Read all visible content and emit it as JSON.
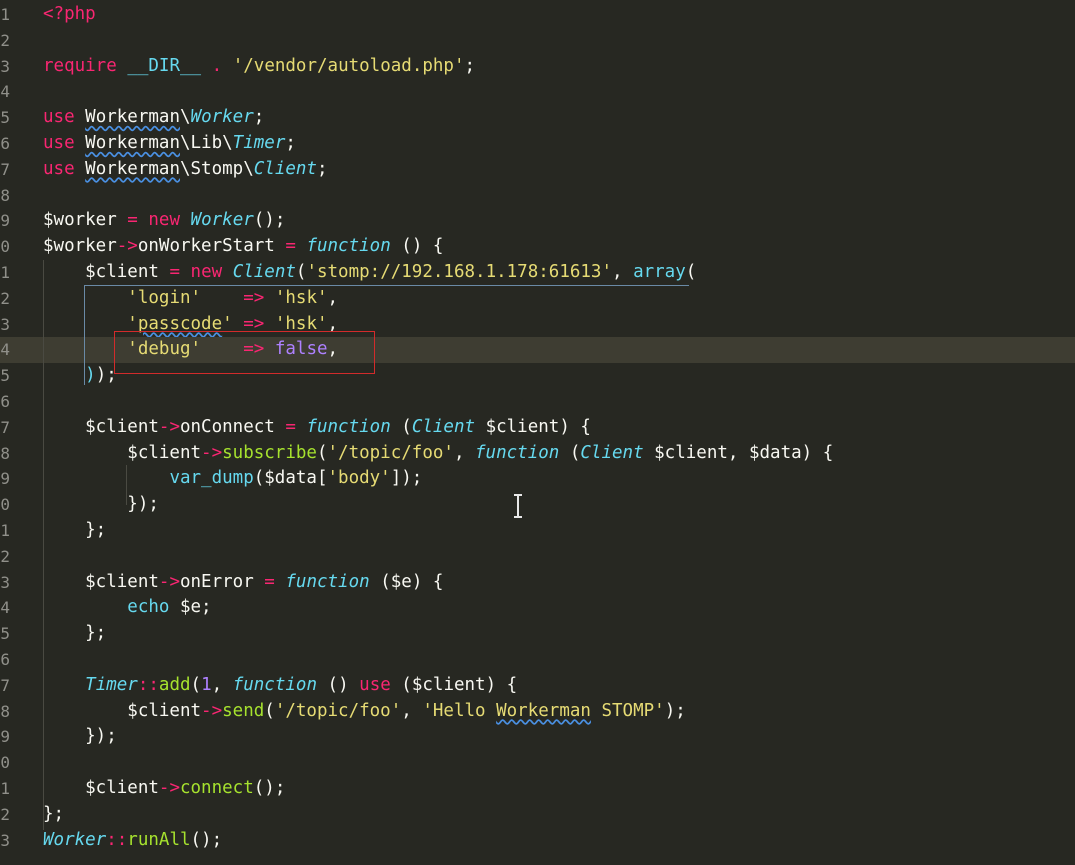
{
  "editor": {
    "language": "php",
    "theme_colors": {
      "background": "#272822",
      "keyword": "#f92672",
      "string": "#e6db74",
      "class": "#66d9ef",
      "function": "#a6e22e",
      "constant": "#ae81ff",
      "annotation_box": "#d22b2b"
    },
    "line_numbers": [
      "1",
      "2",
      "3",
      "4",
      "5",
      "6",
      "7",
      "8",
      "9",
      "0",
      "1",
      "2",
      "3",
      "4",
      "5",
      "6",
      "7",
      "8",
      "9",
      "0",
      "1",
      "2",
      "3",
      "4",
      "5",
      "6",
      "7",
      "8",
      "9",
      "0",
      "1",
      "2",
      "3"
    ],
    "highlighted_line": 14,
    "lines": [
      [
        [
          "kw",
          "<?php"
        ]
      ],
      [],
      [
        [
          "kw",
          "require"
        ],
        [
          "plain",
          " "
        ],
        [
          "cls-plain",
          "__DIR__"
        ],
        [
          "plain",
          " "
        ],
        [
          "op",
          "."
        ],
        [
          "plain",
          " "
        ],
        [
          "str",
          "'/vendor/autoload.php'"
        ],
        [
          "plain",
          ";"
        ]
      ],
      [],
      [
        [
          "kw",
          "use"
        ],
        [
          "plain",
          " "
        ],
        [
          "wavy",
          "Workerman"
        ],
        [
          "plain",
          "\\"
        ],
        [
          "cls",
          "Worker"
        ],
        [
          "plain",
          ";"
        ]
      ],
      [
        [
          "kw",
          "use"
        ],
        [
          "plain",
          " "
        ],
        [
          "wavy",
          "Workerman"
        ],
        [
          "plain",
          "\\Lib\\"
        ],
        [
          "cls",
          "Timer"
        ],
        [
          "plain",
          ";"
        ]
      ],
      [
        [
          "kw",
          "use"
        ],
        [
          "plain",
          " "
        ],
        [
          "wavy",
          "Workerman"
        ],
        [
          "plain",
          "\\Stomp\\"
        ],
        [
          "cls",
          "Client"
        ],
        [
          "plain",
          ";"
        ]
      ],
      [],
      [
        [
          "plain",
          "$worker "
        ],
        [
          "op",
          "="
        ],
        [
          "plain",
          " "
        ],
        [
          "kw",
          "new"
        ],
        [
          "plain",
          " "
        ],
        [
          "cls",
          "Worker"
        ],
        [
          "plain",
          "();"
        ]
      ],
      [
        [
          "plain",
          "$worker"
        ],
        [
          "op",
          "->"
        ],
        [
          "plain",
          "onWorkerStart "
        ],
        [
          "op",
          "="
        ],
        [
          "plain",
          " "
        ],
        [
          "fnkw",
          "function"
        ],
        [
          "plain",
          " () {"
        ]
      ],
      [
        [
          "plain",
          "    $client "
        ],
        [
          "op",
          "="
        ],
        [
          "plain",
          " "
        ],
        [
          "kw",
          "new"
        ],
        [
          "plain",
          " "
        ],
        [
          "cls",
          "Client"
        ],
        [
          "plain",
          "("
        ],
        [
          "str",
          "'stomp://192.168.1.178:61613'"
        ],
        [
          "plain",
          ", "
        ],
        [
          "sup",
          "array"
        ],
        [
          "plain",
          "("
        ]
      ],
      [
        [
          "plain",
          "        "
        ],
        [
          "str",
          "'login'"
        ],
        [
          "plain",
          "    "
        ],
        [
          "op",
          "=>"
        ],
        [
          "plain",
          " "
        ],
        [
          "str",
          "'hsk'"
        ],
        [
          "plain",
          ","
        ]
      ],
      [
        [
          "plain",
          "        "
        ],
        [
          "str",
          "'"
        ],
        [
          "strwavy",
          "passcode"
        ],
        [
          "str",
          "'"
        ],
        [
          "plain",
          " "
        ],
        [
          "op",
          "=>"
        ],
        [
          "plain",
          " "
        ],
        [
          "str",
          "'hsk'"
        ],
        [
          "plain",
          ","
        ]
      ],
      [
        [
          "plain",
          "        "
        ],
        [
          "str",
          "'debug'"
        ],
        [
          "plain",
          "    "
        ],
        [
          "op",
          "=>"
        ],
        [
          "plain",
          " "
        ],
        [
          "const",
          "false"
        ],
        [
          "plain",
          ","
        ]
      ],
      [
        [
          "plain",
          "    "
        ],
        [
          "bracket-hl",
          ")"
        ],
        [
          "plain",
          ");"
        ]
      ],
      [],
      [
        [
          "plain",
          "    $client"
        ],
        [
          "op",
          "->"
        ],
        [
          "plain",
          "onConnect "
        ],
        [
          "op",
          "="
        ],
        [
          "plain",
          " "
        ],
        [
          "fnkw",
          "function"
        ],
        [
          "plain",
          " ("
        ],
        [
          "cls",
          "Client"
        ],
        [
          "plain",
          " $client) {"
        ]
      ],
      [
        [
          "plain",
          "        $client"
        ],
        [
          "op",
          "->"
        ],
        [
          "fn",
          "subscribe"
        ],
        [
          "plain",
          "("
        ],
        [
          "str",
          "'/topic/foo'"
        ],
        [
          "plain",
          ", "
        ],
        [
          "fnkw",
          "function"
        ],
        [
          "plain",
          " ("
        ],
        [
          "cls",
          "Client"
        ],
        [
          "plain",
          " $client, $data) {"
        ]
      ],
      [
        [
          "plain",
          "            "
        ],
        [
          "sup",
          "var_dump"
        ],
        [
          "plain",
          "($data["
        ],
        [
          "str",
          "'body'"
        ],
        [
          "plain",
          "]);"
        ]
      ],
      [
        [
          "plain",
          "        });"
        ]
      ],
      [
        [
          "plain",
          "    };"
        ]
      ],
      [],
      [
        [
          "plain",
          "    $client"
        ],
        [
          "op",
          "->"
        ],
        [
          "plain",
          "onError "
        ],
        [
          "op",
          "="
        ],
        [
          "plain",
          " "
        ],
        [
          "fnkw",
          "function"
        ],
        [
          "plain",
          " ($e) {"
        ]
      ],
      [
        [
          "plain",
          "        "
        ],
        [
          "sup",
          "echo"
        ],
        [
          "plain",
          " $e;"
        ]
      ],
      [
        [
          "plain",
          "    };"
        ]
      ],
      [],
      [
        [
          "plain",
          "    "
        ],
        [
          "cls",
          "Timer"
        ],
        [
          "op",
          "::"
        ],
        [
          "fn",
          "add"
        ],
        [
          "plain",
          "("
        ],
        [
          "const",
          "1"
        ],
        [
          "plain",
          ", "
        ],
        [
          "fnkw",
          "function"
        ],
        [
          "plain",
          " () "
        ],
        [
          "kw",
          "use"
        ],
        [
          "plain",
          " ($client) {"
        ]
      ],
      [
        [
          "plain",
          "        $client"
        ],
        [
          "op",
          "->"
        ],
        [
          "fn",
          "send"
        ],
        [
          "plain",
          "("
        ],
        [
          "str",
          "'/topic/foo'"
        ],
        [
          "plain",
          ", "
        ],
        [
          "str",
          "'Hello "
        ],
        [
          "strwavy",
          "Workerman"
        ],
        [
          "str",
          " STOMP'"
        ],
        [
          "plain",
          ");"
        ]
      ],
      [
        [
          "plain",
          "    });"
        ]
      ],
      [],
      [
        [
          "plain",
          "    $client"
        ],
        [
          "op",
          "->"
        ],
        [
          "fn",
          "connect"
        ],
        [
          "plain",
          "();"
        ]
      ],
      [
        [
          "plain",
          "};"
        ]
      ],
      [
        [
          "cls",
          "Worker"
        ],
        [
          "op",
          "::"
        ],
        [
          "fn",
          "runAll"
        ],
        [
          "plain",
          "();"
        ]
      ]
    ]
  }
}
